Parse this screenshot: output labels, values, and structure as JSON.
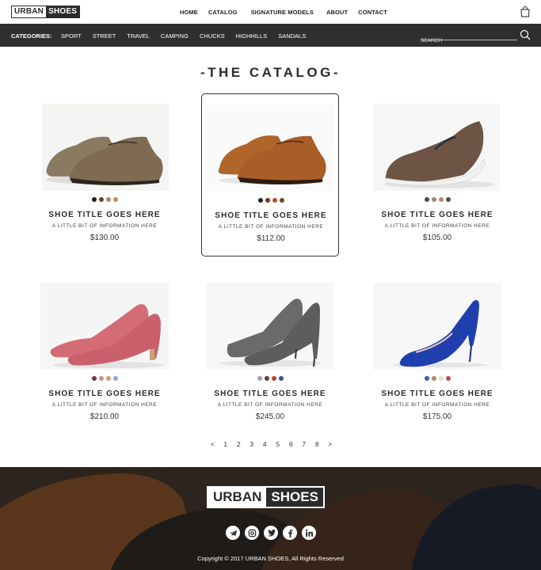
{
  "header": {
    "logo_part1": "URBAN",
    "logo_part2": "SHOES",
    "nav": [
      "HOME",
      "CATALOG",
      "SIGNATURE MODELS",
      "ABOUT",
      "CONTACT"
    ]
  },
  "categories": {
    "label": "CATEGORIES:",
    "items": [
      "SPORT",
      "STREET",
      "TRAVEL",
      "CAMPING",
      "CHUCKS",
      "HIGHHILLS",
      "SANDALS"
    ],
    "search_placeholder": "SEARCH"
  },
  "catalog": {
    "title": "-THE CATALOG-",
    "products": [
      {
        "title": "SHOE TITLE GOES HERE",
        "info": "A LITTLE BIT OF INFORMATION HERE",
        "price": "$130.00",
        "swatches": [
          "#1f1f1f",
          "#5a4a3c",
          "#a7896c",
          "#c38a5a"
        ]
      },
      {
        "title": "SHOE TITLE GOES HERE",
        "info": "A LITTLE BIT OF INFORMATION HERE",
        "price": "$112.00",
        "swatches": [
          "#1f1f1f",
          "#6b3f21",
          "#a05a2a",
          "#7a4420"
        ]
      },
      {
        "title": "SHOE TITLE GOES HERE",
        "info": "A LITTLE BIT OF INFORMATION HERE",
        "price": "$105.00",
        "swatches": [
          "#5c4638",
          "#a38478",
          "#c4816f",
          "#41535e"
        ]
      },
      {
        "title": "SHOE TITLE GOES HERE",
        "info": "A LITTLE BIT OF INFORMATION HERE",
        "price": "$210.00",
        "swatches": [
          "#6b3a33",
          "#d98b86",
          "#c8a175",
          "#8aa7d6"
        ]
      },
      {
        "title": "SHOE TITLE GOES HERE",
        "info": "A LITTLE BIT OF INFORMATION HERE",
        "price": "$245.00",
        "swatches": [
          "#a3a3a3",
          "#6b3a2c",
          "#b73b3b",
          "#3a4f8e"
        ]
      },
      {
        "title": "SHOE TITLE GOES HERE",
        "info": "A LITTLE BIT OF INFORMATION HERE",
        "price": "$175.00",
        "swatches": [
          "#3a5aa8",
          "#b87f6a",
          "#e7dccd",
          "#c7474b"
        ]
      }
    ]
  },
  "pagination": {
    "prev": "<",
    "pages": [
      "1",
      "2",
      "3",
      "4",
      "5",
      "6",
      "7",
      "8"
    ],
    "next": ">"
  },
  "footer": {
    "logo_part1": "URBAN",
    "logo_part2": "SHOES",
    "socials": [
      "telegram-icon",
      "instagram-icon",
      "twitter-icon",
      "facebook-icon",
      "linkedin-icon"
    ],
    "copyright": "Copyright © 2017 URBAN SHOES, All Rights Reserved"
  },
  "colors": {
    "dark": "#2f2f2f",
    "white": "#ffffff"
  }
}
